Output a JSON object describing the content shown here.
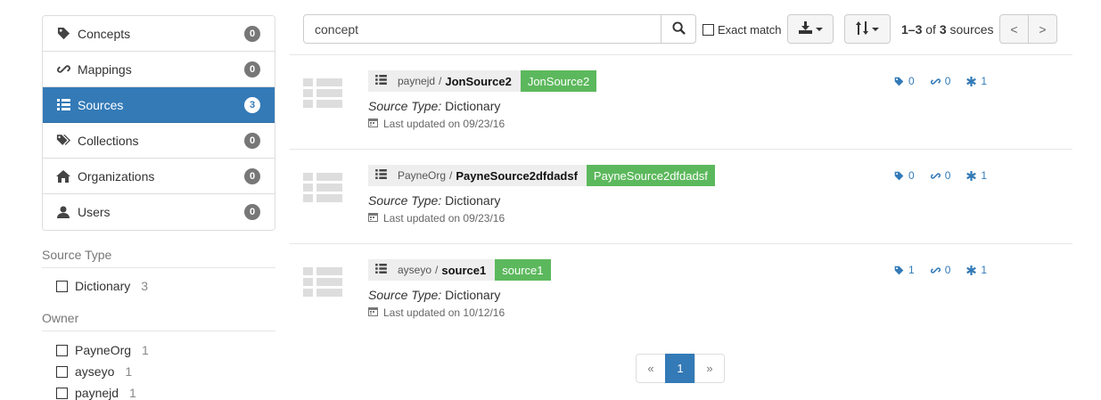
{
  "sidebar": {
    "items": [
      {
        "label": "Concepts",
        "count": "0"
      },
      {
        "label": "Mappings",
        "count": "0"
      },
      {
        "label": "Sources",
        "count": "3"
      },
      {
        "label": "Collections",
        "count": "0"
      },
      {
        "label": "Organizations",
        "count": "0"
      },
      {
        "label": "Users",
        "count": "0"
      }
    ],
    "facets": {
      "source_type": {
        "title": "Source Type",
        "options": [
          {
            "label": "Dictionary",
            "count": "3"
          }
        ]
      },
      "owner": {
        "title": "Owner",
        "options": [
          {
            "label": "PayneOrg",
            "count": "1"
          },
          {
            "label": "ayseyo",
            "count": "1"
          },
          {
            "label": "paynejd",
            "count": "1"
          }
        ]
      }
    }
  },
  "toolbar": {
    "search_value": "concept",
    "exact_match_label": "Exact match",
    "range_start": "1–3",
    "range_of": "of",
    "range_total": "3",
    "range_label": "sources",
    "prev_label": "<",
    "next_label": ">"
  },
  "results": [
    {
      "owner": "paynejd",
      "name": "JonSource2",
      "tag": "JonSource2",
      "type_label": "Source Type:",
      "type_value": "Dictionary",
      "updated": "Last updated on 09/23/16",
      "concepts": "0",
      "mappings": "0",
      "versions": "1"
    },
    {
      "owner": "PayneOrg",
      "name": "PayneSource2dfdadsf",
      "tag": "PayneSource2dfdadsf",
      "type_label": "Source Type:",
      "type_value": "Dictionary",
      "updated": "Last updated on 09/23/16",
      "concepts": "0",
      "mappings": "0",
      "versions": "1"
    },
    {
      "owner": "ayseyo",
      "name": "source1",
      "tag": "source1",
      "type_label": "Source Type:",
      "type_value": "Dictionary",
      "updated": "Last updated on 10/12/16",
      "concepts": "1",
      "mappings": "0",
      "versions": "1"
    }
  ],
  "pagination": {
    "prev": "«",
    "current": "1",
    "next": "»"
  },
  "colors": {
    "primary": "#337ab7",
    "success": "#5cb85c",
    "badge": "#777777"
  }
}
